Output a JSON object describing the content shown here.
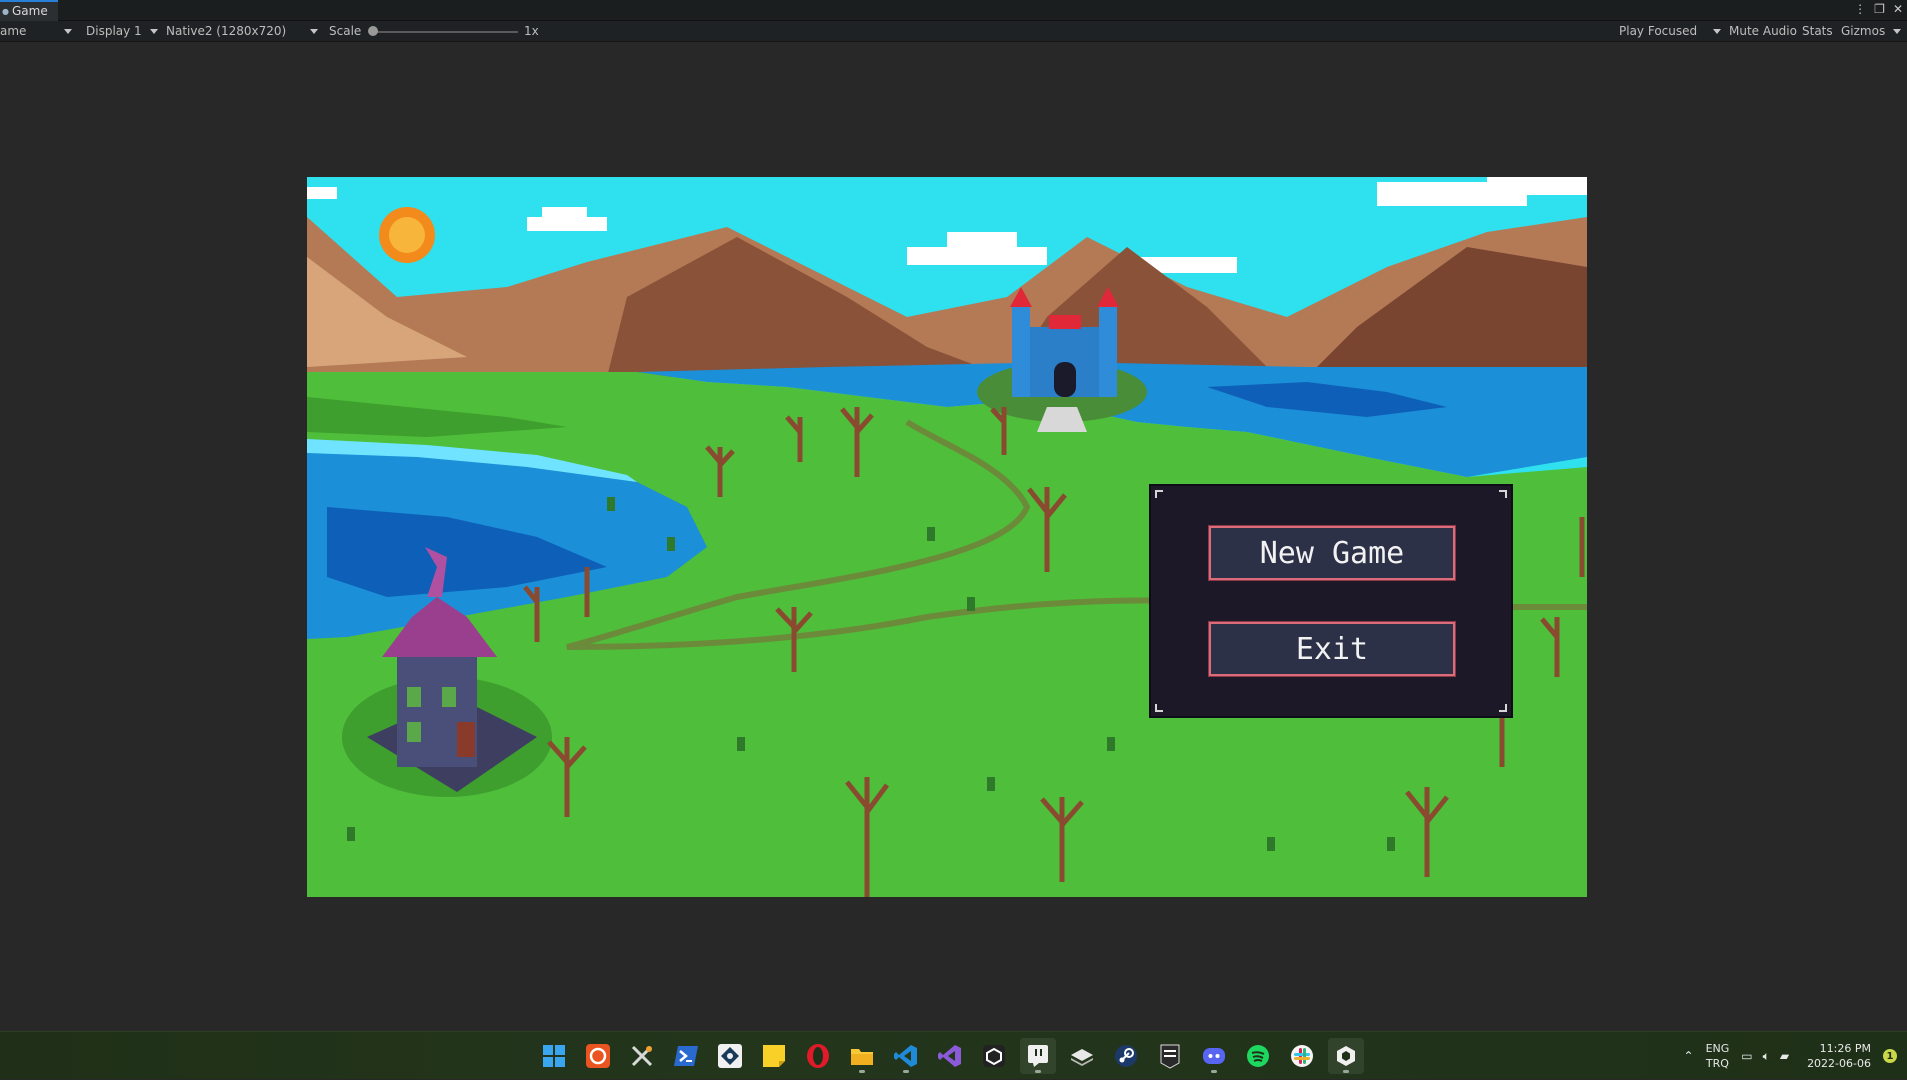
{
  "window": {
    "tab_label": "Game",
    "tab_icon": "game-controller-icon",
    "controls": [
      "⋮",
      "❐",
      "✕"
    ]
  },
  "toolbar": {
    "game_dropdown": "ame",
    "display_dropdown": "Display 1",
    "resolution_dropdown": "Native2 (1280x720)",
    "scale_label": "Scale",
    "scale_value": "1x",
    "play_mode": "Play Focused",
    "mute_audio": "Mute Audio",
    "stats": "Stats",
    "gizmos": "Gizmos"
  },
  "game": {
    "menu": {
      "new_game": "New Game",
      "exit": "Exit"
    }
  },
  "taskbar": {
    "icons": [
      "windows-start-icon",
      "ubuntu-icon",
      "tools-icon",
      "powershell-icon",
      "github-icon",
      "sticky-notes-icon",
      "opera-icon",
      "file-explorer-icon",
      "vscode-icon",
      "visual-studio-icon",
      "unity-hub-icon",
      "twitch-icon",
      "itch-icon",
      "steam-icon",
      "epic-games-icon",
      "discord-icon",
      "spotify-icon",
      "slack-icon",
      "unity-icon"
    ],
    "lang_top": "ENG",
    "lang_bottom": "TRQ",
    "time": "11:26 PM",
    "date": "2022-06-06",
    "notification_count": "1"
  },
  "colors": {
    "sky": "#2fe0ef",
    "grass": "#4fbe3a",
    "water": "#1b8fd8",
    "panel": "#1c1828",
    "button_border": "#d96b7a"
  }
}
